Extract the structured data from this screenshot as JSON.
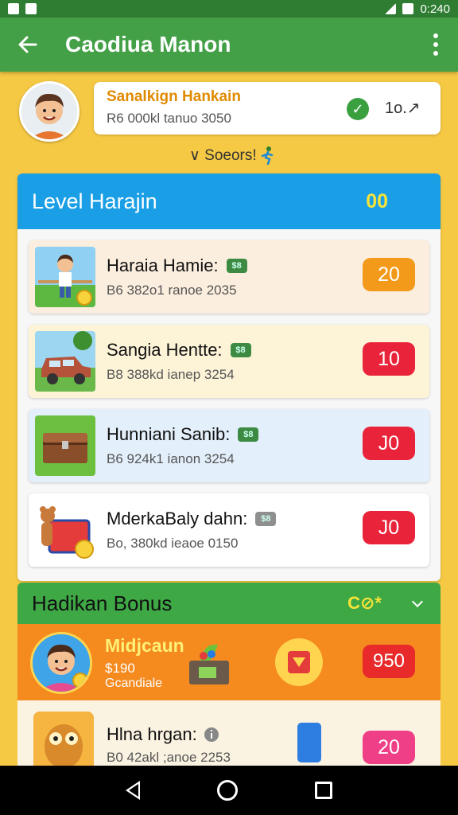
{
  "status_bar": {
    "time": "0:240"
  },
  "app_bar": {
    "title": "Caodiua Manon"
  },
  "profile": {
    "name": "Sanalkign Hankain",
    "subtitle": "R6 000kl tanuo 3050",
    "count": "1o.↗"
  },
  "sorter": {
    "label": "∨ Soeors!"
  },
  "level": {
    "title": "Level Harajin",
    "score": "00",
    "tasks": [
      {
        "title": "Haraia Hamie:",
        "subtitle": "B6 382o1 ranoe 2035",
        "reward": "20",
        "badge_color": "#f39a1a",
        "card_color": "#fbeede",
        "cash": "$8"
      },
      {
        "title": "Sangia Hentte:",
        "subtitle": "B8 388kd ianep 3254",
        "reward": "10",
        "badge_color": "#e8233a",
        "card_color": "#fdf4d8",
        "cash": "$8"
      },
      {
        "title": "Hunniani Sanib:",
        "subtitle": "B6 924k1 ianon 3254",
        "reward": "J0",
        "badge_color": "#e8233a",
        "card_color": "#e3effa",
        "cash": "$8"
      },
      {
        "title": "MderkaBaly dahn:",
        "subtitle": "Bo, 380kd ieaoe 0150",
        "reward": "J0",
        "badge_color": "#e8233a",
        "card_color": "#ffffff",
        "cash": "$8"
      }
    ]
  },
  "bonus": {
    "title": "Hadikan Bonus",
    "score": "C⊘*",
    "promo": {
      "name": "Midjcaun",
      "amount": "$190",
      "label": "Gcandiale",
      "reward": "950"
    },
    "item": {
      "title": "Hlna hrgan:",
      "subtitle": "B0 42akl ;anoe 2253",
      "reward": "20"
    }
  }
}
